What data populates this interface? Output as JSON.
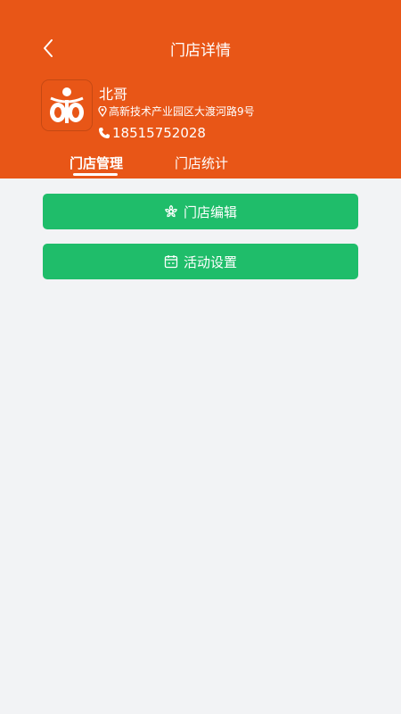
{
  "header": {
    "title": "门店详情",
    "bg_color": "#e85617"
  },
  "store": {
    "name": "北哥",
    "address": "高新技术产业园区大渡河路9号",
    "phone": "18515752028"
  },
  "tabs": [
    {
      "label": "门店管理",
      "active": true
    },
    {
      "label": "门店统计",
      "active": false
    }
  ],
  "actions": [
    {
      "label": "门店编辑",
      "icon": "flower-settings-icon"
    },
    {
      "label": "活动设置",
      "icon": "calendar-icon"
    }
  ],
  "colors": {
    "primary_orange": "#e85617",
    "button_green": "#1fbd6a",
    "page_bg": "#f2f3f5"
  }
}
